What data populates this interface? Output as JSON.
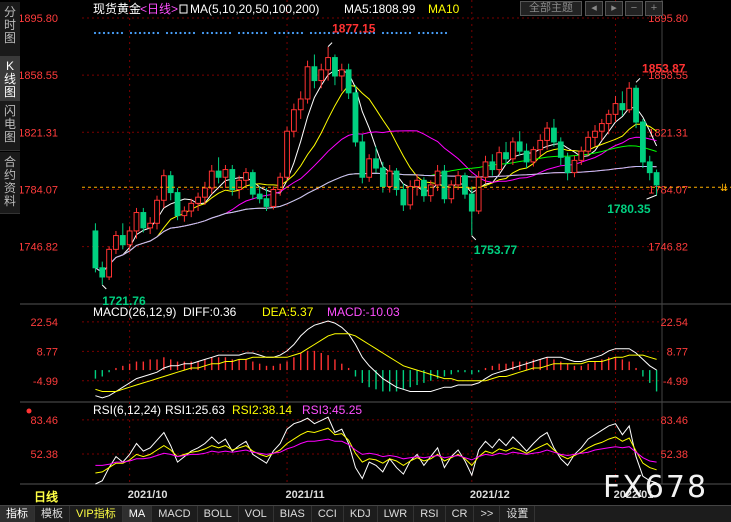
{
  "sidebar": {
    "tabs": [
      {
        "label": "分时图",
        "active": false
      },
      {
        "label": "K线图",
        "active": true
      },
      {
        "label": "闪电图",
        "active": false
      },
      {
        "label": "合约资料",
        "active": false
      }
    ]
  },
  "header": {
    "title": "现货黄金",
    "period": "<日线>",
    "ma_label": "MA(5,10,20,50,100,200)",
    "ma5_label": "MA5:1808.99",
    "ma10_label": "MA10",
    "theme_button": "全部主题"
  },
  "colors": {
    "up": "#ff3232",
    "down": "#00d080",
    "ma5": "#ffffff",
    "ma10": "#ffff00",
    "ma20": "#ff00ff",
    "ma50": "#00ff00",
    "ma100": "#ff5050",
    "ma200": "#c0c0ff",
    "dif": "#ffffff",
    "dea": "#ffff00",
    "rsi1": "#ffffff",
    "rsi2": "#ffff00",
    "rsi3": "#ff00ff",
    "grid": "#7a0000",
    "axis": "#ff3c3c"
  },
  "chart_data": [
    {
      "type": "candlestick",
      "title": "现货黄金",
      "y_ticks": [
        1895.8,
        1858.55,
        1821.31,
        1784.07,
        1746.82
      ],
      "ylim": [
        1712,
        1901
      ],
      "x_ticks": [
        "2021/10",
        "2021/11",
        "2021/12",
        "2022/01"
      ],
      "annotations": [
        {
          "label": "1877.15",
          "value": 1877.15
        },
        {
          "label": "1853.87",
          "value": 1853.87
        },
        {
          "label": "1721.76",
          "value": 1721.76
        },
        {
          "label": "1753.77",
          "value": 1753.77
        },
        {
          "label": "1780.35",
          "value": 1780.35
        }
      ],
      "current_price": 1785.5,
      "legend": [
        "MA5:1808.99",
        "MA10"
      ],
      "ohlc": [
        [
          1757,
          1762,
          1730,
          1733
        ],
        [
          1733,
          1737,
          1722,
          1727
        ],
        [
          1727,
          1747,
          1725,
          1745
        ],
        [
          1745,
          1757,
          1742,
          1754
        ],
        [
          1754,
          1762,
          1745,
          1748
        ],
        [
          1748,
          1760,
          1744,
          1757
        ],
        [
          1757,
          1772,
          1752,
          1769
        ],
        [
          1769,
          1772,
          1756,
          1759
        ],
        [
          1759,
          1766,
          1755,
          1762
        ],
        [
          1762,
          1780,
          1758,
          1777
        ],
        [
          1777,
          1797,
          1772,
          1793
        ],
        [
          1793,
          1796,
          1777,
          1782
        ],
        [
          1782,
          1785,
          1764,
          1767
        ],
        [
          1767,
          1773,
          1763,
          1770
        ],
        [
          1770,
          1778,
          1766,
          1775
        ],
        [
          1775,
          1782,
          1770,
          1779
        ],
        [
          1779,
          1789,
          1774,
          1785
        ],
        [
          1785,
          1800,
          1781,
          1796
        ],
        [
          1796,
          1805,
          1788,
          1792
        ],
        [
          1792,
          1800,
          1785,
          1797
        ],
        [
          1797,
          1800,
          1780,
          1784
        ],
        [
          1784,
          1793,
          1778,
          1790
        ],
        [
          1790,
          1798,
          1786,
          1795
        ],
        [
          1795,
          1797,
          1778,
          1781
        ],
        [
          1781,
          1786,
          1775,
          1778
        ],
        [
          1778,
          1785,
          1770,
          1773
        ],
        [
          1773,
          1786,
          1771,
          1784
        ],
        [
          1784,
          1795,
          1780,
          1792
        ],
        [
          1792,
          1825,
          1790,
          1822
        ],
        [
          1822,
          1840,
          1818,
          1836
        ],
        [
          1836,
          1848,
          1830,
          1843
        ],
        [
          1843,
          1868,
          1840,
          1864
        ],
        [
          1864,
          1872,
          1850,
          1855
        ],
        [
          1855,
          1866,
          1850,
          1862
        ],
        [
          1862,
          1877,
          1855,
          1870
        ],
        [
          1870,
          1872,
          1852,
          1858
        ],
        [
          1858,
          1866,
          1848,
          1862
        ],
        [
          1862,
          1866,
          1843,
          1847
        ],
        [
          1847,
          1852,
          1812,
          1815
        ],
        [
          1815,
          1820,
          1788,
          1792
        ],
        [
          1792,
          1807,
          1789,
          1804
        ],
        [
          1804,
          1812,
          1795,
          1798
        ],
        [
          1798,
          1802,
          1782,
          1786
        ],
        [
          1786,
          1800,
          1782,
          1796
        ],
        [
          1796,
          1798,
          1780,
          1784
        ],
        [
          1784,
          1788,
          1770,
          1774
        ],
        [
          1774,
          1790,
          1771,
          1786
        ],
        [
          1786,
          1794,
          1780,
          1790
        ],
        [
          1790,
          1792,
          1776,
          1780
        ],
        [
          1780,
          1790,
          1776,
          1787
        ],
        [
          1787,
          1800,
          1783,
          1796
        ],
        [
          1796,
          1800,
          1775,
          1778
        ],
        [
          1778,
          1790,
          1775,
          1787
        ],
        [
          1787,
          1796,
          1784,
          1793
        ],
        [
          1793,
          1795,
          1778,
          1781
        ],
        [
          1781,
          1786,
          1754,
          1770
        ],
        [
          1770,
          1796,
          1768,
          1792
        ],
        [
          1792,
          1806,
          1788,
          1802
        ],
        [
          1802,
          1807,
          1793,
          1797
        ],
        [
          1797,
          1812,
          1794,
          1808
        ],
        [
          1808,
          1815,
          1800,
          1804
        ],
        [
          1804,
          1818,
          1800,
          1815
        ],
        [
          1815,
          1822,
          1806,
          1809
        ],
        [
          1809,
          1814,
          1798,
          1802
        ],
        [
          1802,
          1812,
          1799,
          1810
        ],
        [
          1810,
          1820,
          1806,
          1816
        ],
        [
          1816,
          1828,
          1810,
          1824
        ],
        [
          1824,
          1830,
          1812,
          1815
        ],
        [
          1815,
          1818,
          1800,
          1805
        ],
        [
          1805,
          1808,
          1790,
          1795
        ],
        [
          1795,
          1806,
          1792,
          1803
        ],
        [
          1803,
          1812,
          1800,
          1809
        ],
        [
          1809,
          1822,
          1806,
          1818
        ],
        [
          1818,
          1826,
          1812,
          1822
        ],
        [
          1822,
          1830,
          1816,
          1827
        ],
        [
          1827,
          1836,
          1820,
          1833
        ],
        [
          1833,
          1845,
          1828,
          1840
        ],
        [
          1840,
          1848,
          1832,
          1836
        ],
        [
          1836,
          1854,
          1834,
          1850
        ],
        [
          1850,
          1852,
          1824,
          1828
        ],
        [
          1828,
          1830,
          1798,
          1802
        ],
        [
          1802,
          1806,
          1790,
          1795
        ],
        [
          1795,
          1797,
          1780,
          1787
        ]
      ]
    },
    {
      "type": "macd",
      "title": "MACD(26,12,9)",
      "legend": [
        "DIFF:0.36",
        "DEA:5.37",
        "MACD:-10.03"
      ],
      "y_ticks": [
        22.54,
        8.77,
        -4.99
      ],
      "ylim": [
        -14,
        30
      ],
      "hist": [
        -4,
        -3,
        -1,
        1,
        2,
        3,
        4,
        4,
        5,
        5,
        6,
        5,
        4,
        4,
        4,
        4,
        5,
        6,
        6,
        6,
        5,
        5,
        5,
        4,
        3,
        2,
        2,
        3,
        4,
        6,
        8,
        9,
        9,
        8,
        7,
        5,
        3,
        1,
        -3,
        -6,
        -8,
        -9,
        -10,
        -10,
        -10,
        -9,
        -8,
        -7,
        -6,
        -5,
        -4,
        -3,
        -2,
        -1,
        -1,
        -2,
        -1,
        1,
        2,
        3,
        3,
        4,
        4,
        4,
        5,
        5,
        6,
        5,
        4,
        3,
        2,
        2,
        3,
        4,
        5,
        6,
        6,
        5,
        4,
        1,
        -3,
        -6,
        -10
      ],
      "dif": [
        -12,
        -13,
        -12,
        -10,
        -8,
        -6,
        -4,
        -3,
        -2,
        -1,
        1,
        2,
        2,
        3,
        3,
        4,
        5,
        6,
        7,
        7,
        7,
        7,
        8,
        8,
        7,
        6,
        6,
        7,
        9,
        12,
        16,
        19,
        21,
        22,
        23,
        22,
        20,
        17,
        12,
        6,
        2,
        -1,
        -4,
        -6,
        -8,
        -9,
        -10,
        -10,
        -10,
        -10,
        -9,
        -8,
        -8,
        -7,
        -7,
        -7,
        -6,
        -4,
        -2,
        -1,
        0,
        1,
        2,
        3,
        4,
        5,
        6,
        6,
        6,
        5,
        4,
        4,
        5,
        6,
        7,
        9,
        10,
        10,
        10,
        8,
        5,
        2,
        0
      ],
      "dea": [
        -9,
        -10,
        -10,
        -10,
        -9,
        -8,
        -7,
        -6,
        -5,
        -4,
        -3,
        -2,
        -1,
        0,
        1,
        1,
        2,
        3,
        3,
        4,
        4,
        5,
        5,
        6,
        6,
        6,
        6,
        6,
        6,
        7,
        8,
        10,
        12,
        14,
        16,
        17,
        17,
        17,
        16,
        14,
        12,
        10,
        8,
        6,
        4,
        2,
        1,
        0,
        -1,
        -2,
        -3,
        -4,
        -4,
        -5,
        -5,
        -5,
        -5,
        -5,
        -4,
        -3,
        -3,
        -2,
        -1,
        0,
        1,
        1,
        2,
        3,
        3,
        3,
        3,
        3,
        4,
        4,
        4,
        5,
        6,
        6,
        7,
        7,
        7,
        6,
        5
      ]
    },
    {
      "type": "rsi",
      "title": "RSI(6,12,24)",
      "legend": [
        "RSI1:25.63",
        "RSI2:38.14",
        "RSI3:45.25"
      ],
      "y_ticks": [
        83.46,
        52.38
      ],
      "ylim": [
        25,
        98
      ],
      "rsi1": [
        25,
        28,
        40,
        50,
        45,
        52,
        62,
        55,
        58,
        65,
        72,
        60,
        45,
        50,
        55,
        58,
        62,
        68,
        62,
        66,
        55,
        60,
        64,
        52,
        48,
        44,
        55,
        62,
        75,
        80,
        82,
        85,
        80,
        83,
        86,
        72,
        75,
        62,
        40,
        30,
        45,
        42,
        36,
        48,
        40,
        34,
        46,
        52,
        42,
        50,
        58,
        40,
        50,
        56,
        46,
        33,
        56,
        64,
        58,
        66,
        60,
        68,
        62,
        55,
        62,
        68,
        72,
        58,
        48,
        42,
        52,
        58,
        66,
        70,
        74,
        78,
        80,
        70,
        78,
        50,
        32,
        28,
        26
      ],
      "rsi2": [
        35,
        36,
        40,
        44,
        44,
        47,
        52,
        50,
        52,
        56,
        60,
        56,
        50,
        52,
        54,
        55,
        57,
        60,
        58,
        60,
        56,
        58,
        60,
        55,
        52,
        50,
        53,
        56,
        62,
        66,
        70,
        73,
        72,
        74,
        76,
        70,
        71,
        65,
        53,
        45,
        48,
        47,
        44,
        48,
        46,
        42,
        46,
        49,
        46,
        48,
        52,
        46,
        49,
        52,
        48,
        42,
        50,
        55,
        53,
        57,
        55,
        58,
        56,
        53,
        56,
        59,
        62,
        56,
        51,
        48,
        51,
        54,
        58,
        61,
        63,
        66,
        68,
        64,
        67,
        55,
        44,
        40,
        38
      ],
      "rsi3": [
        42,
        42,
        43,
        45,
        45,
        46,
        48,
        48,
        49,
        51,
        53,
        52,
        50,
        51,
        52,
        52,
        53,
        55,
        54,
        55,
        54,
        55,
        56,
        54,
        53,
        52,
        53,
        54,
        57,
        59,
        62,
        64,
        64,
        65,
        66,
        64,
        64,
        61,
        56,
        52,
        53,
        52,
        50,
        51,
        50,
        48,
        49,
        50,
        49,
        50,
        51,
        49,
        50,
        51,
        49,
        47,
        50,
        52,
        51,
        53,
        52,
        54,
        53,
        52,
        53,
        54,
        56,
        54,
        52,
        51,
        52,
        53,
        54,
        56,
        57,
        58,
        59,
        58,
        59,
        54,
        49,
        46,
        45
      ]
    }
  ],
  "bottom_tabs": [
    {
      "label": "指标",
      "kind": "sel"
    },
    {
      "label": "模板",
      "kind": ""
    },
    {
      "label": "VIP指标",
      "kind": "hl"
    },
    {
      "label": "MA",
      "kind": "sel"
    },
    {
      "label": "MACD",
      "kind": ""
    },
    {
      "label": "BOLL",
      "kind": ""
    },
    {
      "label": "VOL",
      "kind": ""
    },
    {
      "label": "BIAS",
      "kind": ""
    },
    {
      "label": "CCI",
      "kind": ""
    },
    {
      "label": "KDJ",
      "kind": ""
    },
    {
      "label": "LWR",
      "kind": ""
    },
    {
      "label": "RSI",
      "kind": ""
    },
    {
      "label": "CR",
      "kind": ""
    },
    {
      "label": ">>",
      "kind": ""
    },
    {
      "label": "设置",
      "kind": ""
    }
  ],
  "period_label": "日线",
  "watermark": "FX678"
}
